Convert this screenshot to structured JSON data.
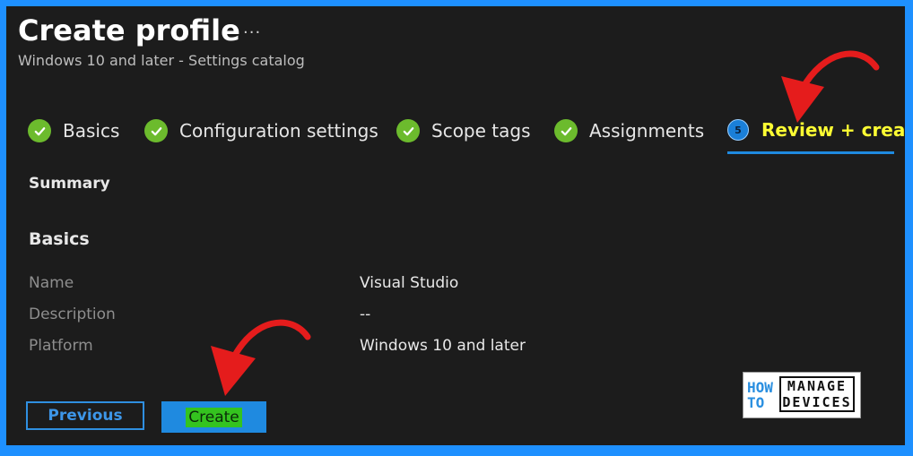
{
  "header": {
    "title": "Create profile",
    "more_label": "...",
    "subtitle": "Windows 10 and later - Settings catalog"
  },
  "steps": [
    {
      "label": "Basics",
      "state": "completed"
    },
    {
      "label": "Configuration settings",
      "state": "completed"
    },
    {
      "label": "Scope tags",
      "state": "completed"
    },
    {
      "label": "Assignments",
      "state": "completed"
    },
    {
      "label": "Review + create",
      "state": "active",
      "number": "5"
    }
  ],
  "summary_heading": "Summary",
  "basics": {
    "heading": "Basics",
    "rows": [
      {
        "label": "Name",
        "value": "Visual Studio"
      },
      {
        "label": "Description",
        "value": "--"
      },
      {
        "label": "Platform",
        "value": "Windows 10 and later"
      }
    ]
  },
  "footer": {
    "previous_label": "Previous",
    "create_label": "Create"
  },
  "logo": {
    "line1": "HOW",
    "line2": "TO",
    "line3": "MANAGE",
    "line4": "DEVICES"
  },
  "colors": {
    "accent": "#1f8ae0",
    "check": "#6cbb2d",
    "active_step_text": "#ffff33",
    "annotation_arrow": "#e51c1c",
    "border": "#1e90ff"
  }
}
